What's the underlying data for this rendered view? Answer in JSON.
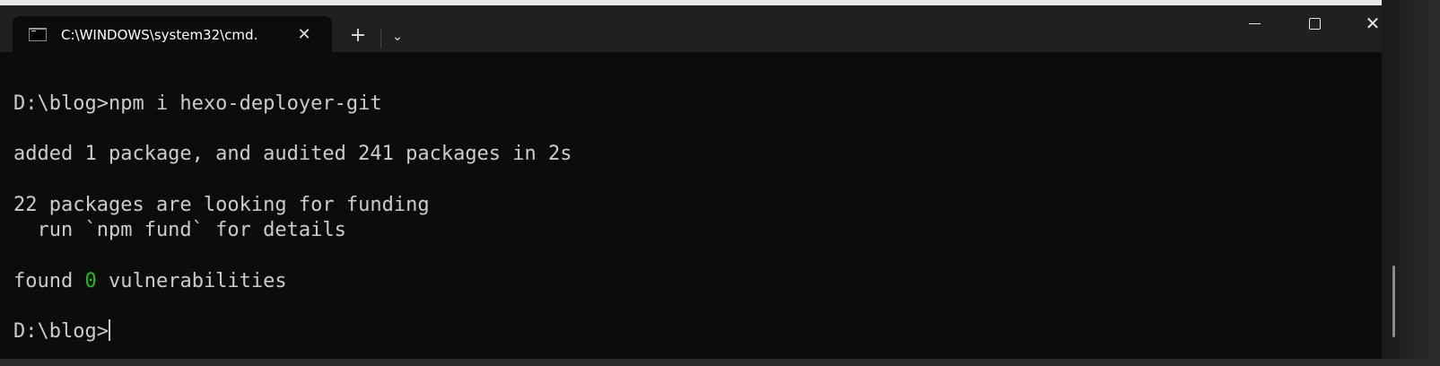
{
  "window": {
    "tab_title": "C:\\WINDOWS\\system32\\cmd.",
    "tab_icon": "cmd-icon",
    "tab_close": "✕",
    "new_tab": "+",
    "dropdown": "⌄",
    "close": "✕"
  },
  "terminal": {
    "lines": [
      "D:\\blog>npm i hexo-deployer-git",
      "added 1 package, and audited 241 packages in 2s",
      "22 packages are looking for funding",
      "  run `npm fund` for details"
    ],
    "found_prefix": "found ",
    "found_count": "0",
    "found_suffix": " vulnerabilities",
    "prompt": "D:\\blog>"
  },
  "colors": {
    "background": "#0c0c0c",
    "text": "#cccccc",
    "green": "#16c60c"
  }
}
